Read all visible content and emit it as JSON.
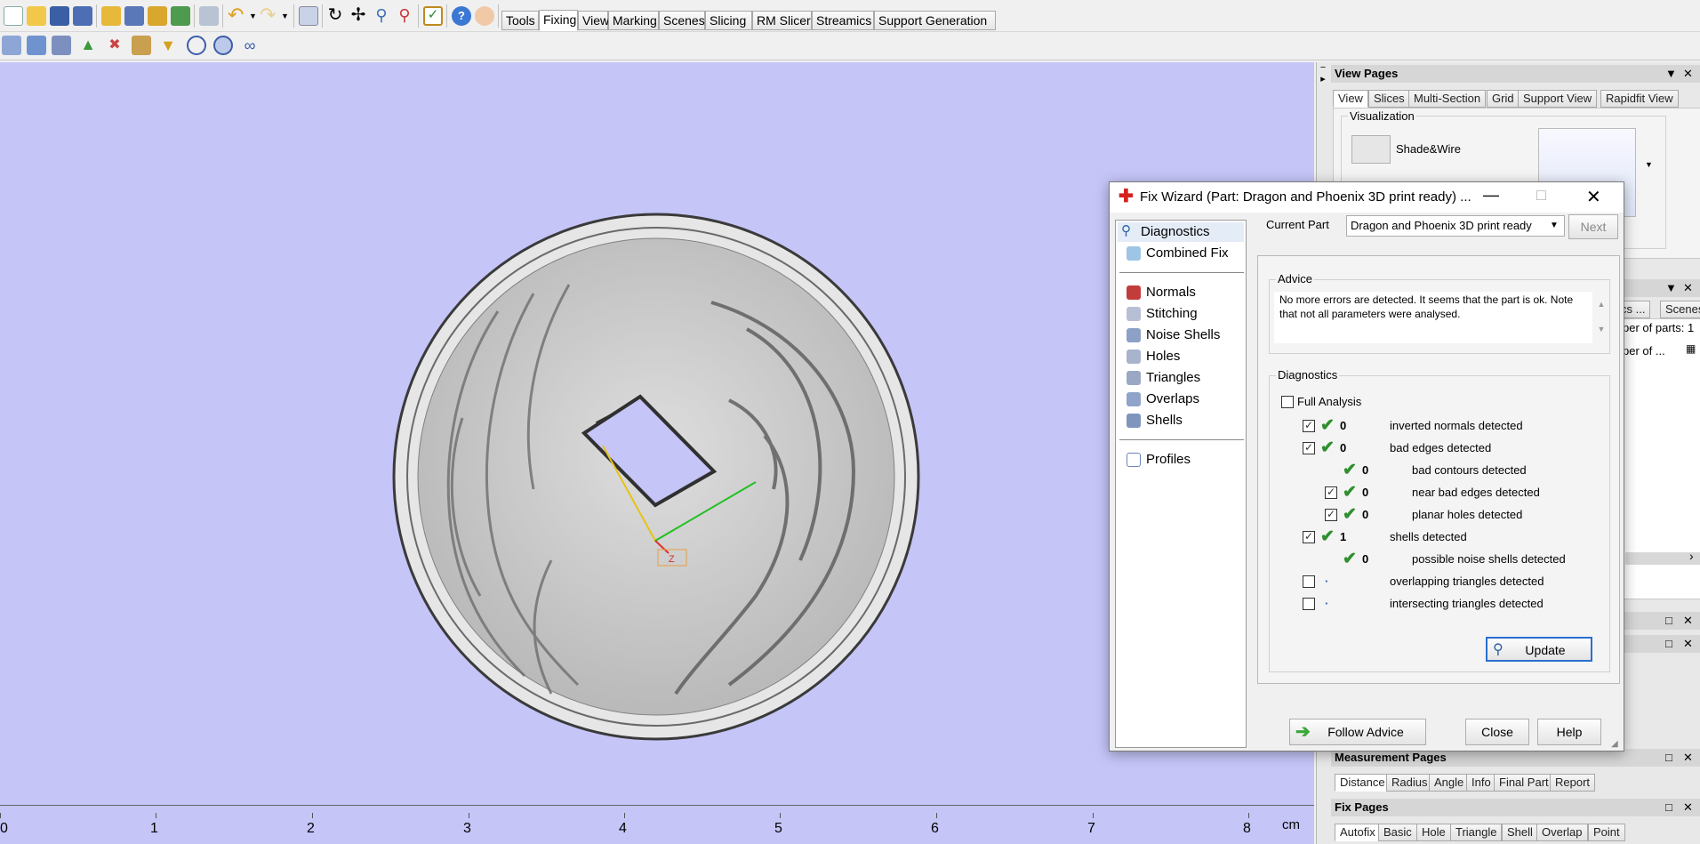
{
  "toolbar": {
    "tabs": [
      "Tools",
      "Fixing",
      "View",
      "Marking",
      "Scenes",
      "Slicing",
      "RM Slicer",
      "Streamics",
      "Support Generation"
    ],
    "active_tab": "Fixing"
  },
  "viewport": {
    "axis_label": "Z",
    "ruler": {
      "labels": [
        "0",
        "1",
        "2",
        "3",
        "4",
        "5",
        "6",
        "7",
        "8"
      ],
      "unit": "cm"
    }
  },
  "view_pages": {
    "title": "View Pages",
    "tabs": [
      "View",
      "Slices",
      "Multi-Section",
      "Grid",
      "Support View",
      "Rapidfit View"
    ],
    "active_tab": "View",
    "group_label": "Visualization",
    "mode_label": "Shade&Wire"
  },
  "parts_panel": {
    "tabs": [
      "cs ...",
      "Scenes"
    ],
    "text1": "per of parts: 1",
    "text2": "per of ..."
  },
  "measurement_pages": {
    "title": "Measurement Pages",
    "tabs": [
      "Distance",
      "Radius",
      "Angle",
      "Info",
      "Final Part",
      "Report"
    ],
    "active_tab": "Distance"
  },
  "fix_pages": {
    "title": "Fix Pages",
    "tabs": [
      "Autofix",
      "Basic",
      "Hole",
      "Triangle",
      "Shell",
      "Overlap",
      "Point"
    ],
    "active_tab": "Autofix"
  },
  "fix_wizard": {
    "title": "Fix Wizard (Part: Dragon and Phoenix 3D print ready) ...",
    "nav_top": [
      "Diagnostics",
      "Combined Fix"
    ],
    "nav_mid": [
      "Normals",
      "Stitching",
      "Noise Shells",
      "Holes",
      "Triangles",
      "Overlaps",
      "Shells"
    ],
    "nav_bottom": [
      "Profiles"
    ],
    "current_part_label": "Current Part",
    "current_part_value": "Dragon and Phoenix 3D print ready",
    "next_label": "Next",
    "advice_label": "Advice",
    "advice_text": "No more errors are detected. It seems that the part is ok. Note that not all parameters were analysed.",
    "diagnostics_label": "Diagnostics",
    "full_analysis_label": "Full Analysis",
    "rows": [
      {
        "count": "0",
        "label": "inverted normals detected"
      },
      {
        "count": "0",
        "label": "bad edges detected"
      },
      {
        "count": "0",
        "label": "bad contours detected"
      },
      {
        "count": "0",
        "label": "near bad edges detected"
      },
      {
        "count": "0",
        "label": "planar holes detected"
      },
      {
        "count": "1",
        "label": "shells detected"
      },
      {
        "count": "0",
        "label": "possible noise shells detected"
      },
      {
        "count": "",
        "label": "overlapping triangles detected"
      },
      {
        "count": "",
        "label": "intersecting triangles detected"
      }
    ],
    "update_label": "Update",
    "follow_advice_label": "Follow Advice",
    "close_label": "Close",
    "help_label": "Help"
  }
}
